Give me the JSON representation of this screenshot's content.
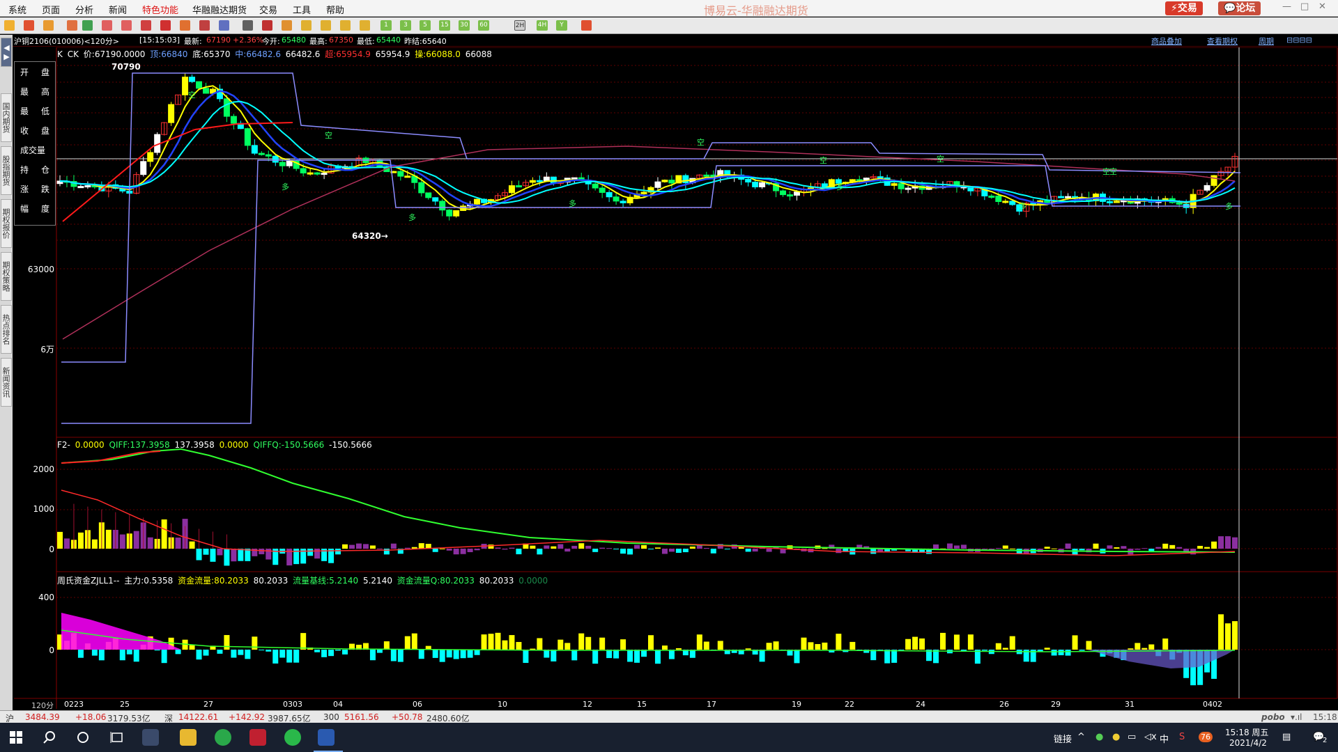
{
  "menu": [
    "系统",
    "页面",
    "分析",
    "新闻",
    "特色功能",
    "华融融达期货",
    "交易",
    "工具",
    "帮助"
  ],
  "app_title": "博易云-华融融达期货",
  "header_buttons": {
    "trade": "⚡交易",
    "forum": "💬论坛"
  },
  "toolbar_periods": [
    "1",
    "3",
    "5",
    "15",
    "30",
    "60",
    "2H",
    "4H",
    "Y"
  ],
  "info": {
    "symbol": "沪铜2106(010006)<120分>",
    "time": "[15:15:03]",
    "latest_label": "最新:",
    "latest": "67190",
    "change": "+2.36%",
    "open_label": "今开:",
    "open": "65480",
    "high_label": "最高:",
    "high": "67350",
    "low_label": "最低:",
    "low": "65440",
    "prev_settle": "昨结:65640",
    "links": [
      "商品叠加",
      "查看期权",
      "周期"
    ]
  },
  "sidetabs": [
    "国内期货",
    "股指期货",
    "期权报价",
    "期权策略",
    "热点排名",
    "新闻资讯"
  ],
  "ohlc_labels": [
    [
      "开",
      "盘"
    ],
    [
      "最",
      "高"
    ],
    [
      "最",
      "低"
    ],
    [
      "收",
      "盘"
    ],
    [
      "成交量",
      ""
    ],
    [
      "持",
      "仓"
    ],
    [
      "涨",
      "跌"
    ],
    [
      "幅",
      "度"
    ]
  ],
  "main_legend": {
    "k": "K",
    "ck": "CK",
    "price": "价:67190.0000",
    "top": "顶:66840",
    "bottom": "底:65370",
    "mid": "中:66482.6",
    "mid_val": "66482.6",
    "over": "超:65954.9",
    "over_val": "65954.9",
    "op": "操:66088.0",
    "op_val": "66088"
  },
  "main_axis": [
    "63000",
    "6万"
  ],
  "main_marks": {
    "high": "70790",
    "low": "64320→",
    "short": "空",
    "long": "多"
  },
  "sub1_legend": {
    "name": "F2-",
    "v0": "0.0000",
    "qiff": "QIFF:137.3958",
    "qiff_val": "137.3958",
    "v1": "0.0000",
    "qiffq": "QIFFQ:-150.5666",
    "qiffq_val": "-150.5666"
  },
  "sub1_axis": [
    "2000",
    "1000",
    "0"
  ],
  "sub2_legend": {
    "name": "周氏资金ZJLL1--",
    "main": "主力:0.5358",
    "flow": "资金流量:80.2033",
    "flow_val": "80.2033",
    "base": "流量基线:5.2140",
    "base_val": "5.2140",
    "flowq": "资金流量Q:80.2033",
    "flowq_val": "80.2033",
    "zero": "0.0000"
  },
  "sub2_axis": [
    "400",
    "0"
  ],
  "period_label": "120分",
  "x_labels": [
    "0223",
    "25",
    "27",
    "0303",
    "04",
    "06",
    "10",
    "12",
    "15",
    "17",
    "19",
    "22",
    "24",
    "26",
    "29",
    "31",
    "0402"
  ],
  "status": {
    "sh_label": "沪",
    "sh": "3484.39",
    "sh_chg": "+18.06",
    "sh_amt": "3179.53亿",
    "sz_label": "深",
    "sz": "14122.61",
    "sz_chg": "+142.92",
    "sz_amt": "3987.65亿",
    "hs_label": "300",
    "hs": "5161.56",
    "hs_chg": "+50.78",
    "hs_amt": "2480.60亿",
    "brand": "pobo",
    "clock": "15:18"
  },
  "tray": {
    "link": "链接",
    "ime": "中",
    "time": "15:18 周五",
    "date": "2021/4/2",
    "notif": "2",
    "badge": "76"
  },
  "colors": {
    "up": "#ff3030",
    "down": "#00ff60",
    "cyan": "#00ffff",
    "yellow": "#ffff00",
    "magenta": "#ff00ff",
    "purple": "#8b2fa0",
    "grid": "#600000"
  }
}
